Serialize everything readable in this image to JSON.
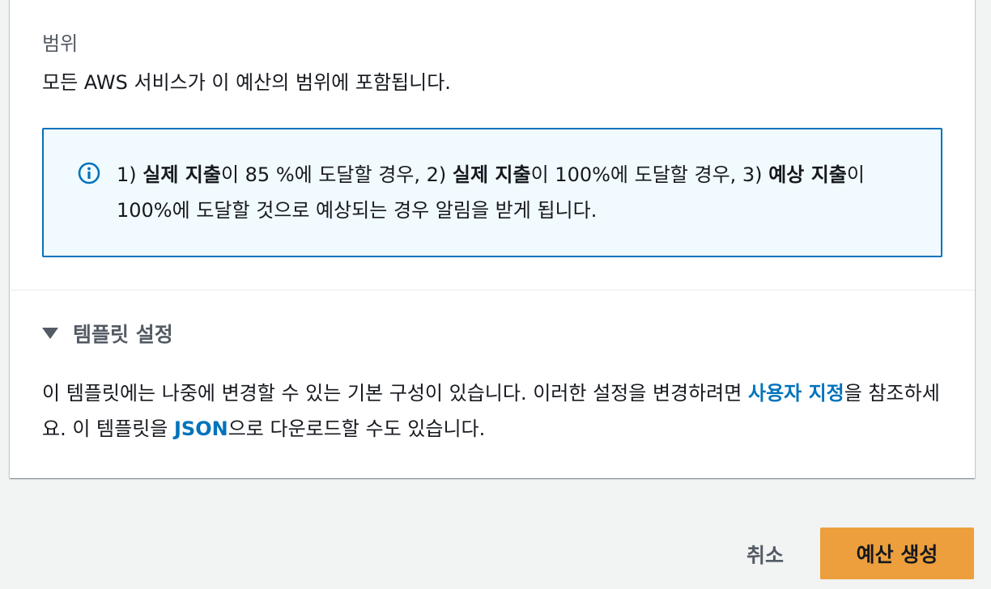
{
  "scope": {
    "label": "범위",
    "value": "모든 AWS 서비스가 이 예산의 범위에 포함됩니다."
  },
  "info": {
    "p1": "1) ",
    "b1": "실제 지출",
    "p2": "이 85 %에 도달할 경우, 2) ",
    "b2": "실제 지출",
    "p3": "이 100%에 도달할 경우, 3) ",
    "b3": "예상 지출",
    "p4": "이 100%에 도달할 것으로 예상되는 경우 알림을 받게 됩니다."
  },
  "template": {
    "title": "템플릿 설정",
    "desc_part1": "이 템플릿에는 나중에 변경할 수 있는 기본 구성이 있습니다. 이러한 설정을 변경하려면 ",
    "customize_link": "사용자 지정",
    "desc_part2": "을 참조하세요. 이 템플릿을 ",
    "json_link": "JSON",
    "desc_part3": "으로 다운로드할 수도 있습니다."
  },
  "footer": {
    "cancel_label": "취소",
    "create_label": "예산 생성"
  },
  "colors": {
    "primary_button": "#ec9f3c",
    "link": "#0073bb",
    "info_border": "#0073bb",
    "info_background": "#f1faff"
  },
  "icons": {
    "info": "info-circle-icon",
    "caret": "caret-down-icon"
  }
}
